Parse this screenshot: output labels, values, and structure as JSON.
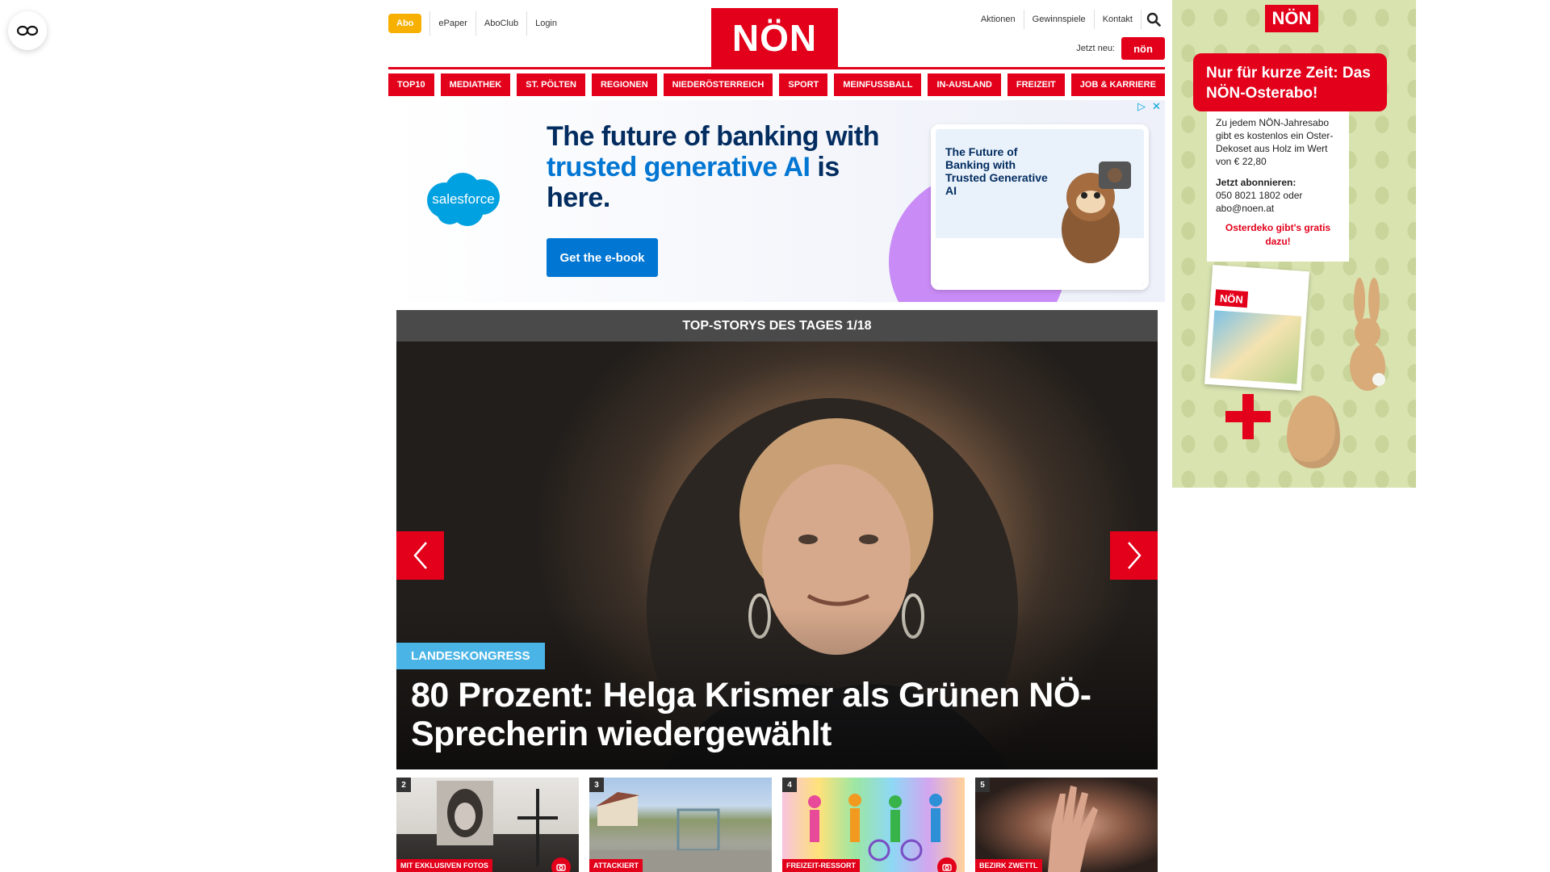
{
  "header": {
    "abo_label": "Abo",
    "left_links": [
      "ePaper",
      "AboClub",
      "Login"
    ],
    "logo_text": "NÖN",
    "right_links": [
      "Aktionen",
      "Gewinnspiele",
      "Kontakt"
    ],
    "jetzt_label": "Jetzt neu:",
    "jetzt_badge": "nön"
  },
  "nav": {
    "items": [
      "TOP10",
      "MEDIATHEK",
      "ST. PÖLTEN",
      "REGIONEN",
      "NIEDERÖSTERREICH",
      "SPORT",
      "MEINFUSSBALL",
      "IN-AUSLAND",
      "FREIZEIT",
      "JOB & KARRIERE"
    ]
  },
  "ad_banner": {
    "brand": "salesforce",
    "headline_part1": "The future of banking with ",
    "headline_highlight": "trusted generative AI",
    "headline_part2": " is here.",
    "cta": "Get the e-book",
    "card_text": "The Future of Banking with Trusted Generative AI"
  },
  "top_stories": {
    "bar_label": "TOP-STORYS DES TAGES 1/18",
    "hero": {
      "tag": "LANDESKONGRESS",
      "title": "80 Prozent: Helga Krismer als Grünen NÖ-Sprecherin wiedergewählt"
    },
    "thumbs": [
      {
        "num": "2",
        "tag": "MIT EXKLUSIVEN FOTOS",
        "has_camera": true
      },
      {
        "num": "3",
        "tag": "ATTACKIERT",
        "has_camera": false
      },
      {
        "num": "4",
        "tag": "FREIZEIT-RESSORT",
        "has_camera": true
      },
      {
        "num": "5",
        "tag": "BEZIRK ZWETTL",
        "has_camera": false
      }
    ]
  },
  "side_ad": {
    "logo": "NÖN",
    "headline": "Nur für kurze Zeit: Das NÖN-Osterabo!",
    "body": "Zu jedem NÖN-Jahresabo gibt es kostenlos ein Oster-Dekoset aus Holz im Wert von € 22,80",
    "cta_title": "Jetzt abonnieren:",
    "phone": "050 8021 1802 oder",
    "email": "abo@noen.at",
    "promo": "Osterdeko gibt's gratis dazu!",
    "mag_logo": "NÖN"
  },
  "colors": {
    "brand_red": "#e2001a",
    "abo_yellow": "#f7b000",
    "tag_blue": "#4ab4e6",
    "sf_blue": "#0176d3"
  }
}
